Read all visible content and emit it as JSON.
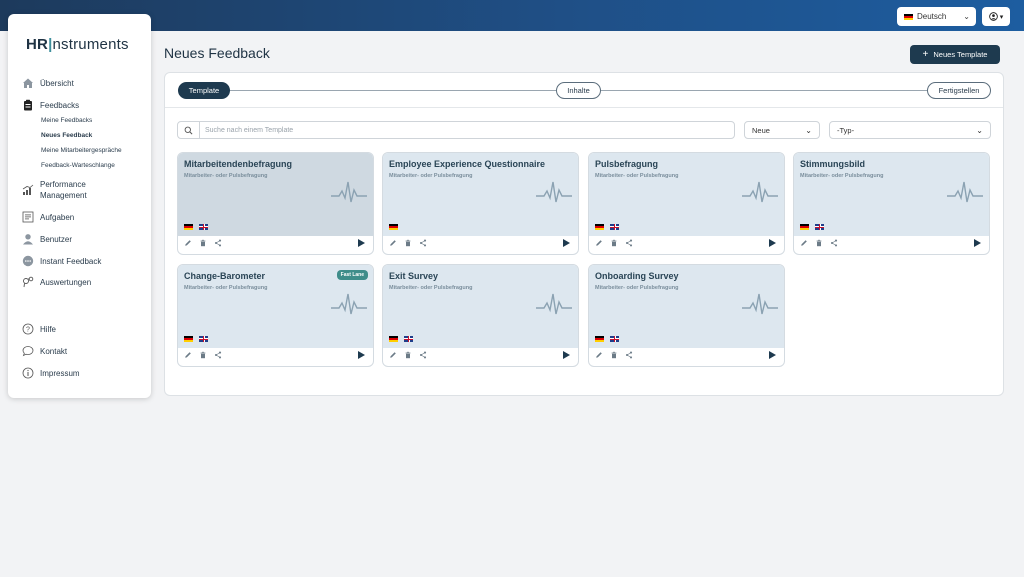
{
  "topbar": {
    "language": "Deutsch"
  },
  "sidebar": {
    "logo_a": "HR",
    "logo_sep": "|",
    "logo_b": "nstruments",
    "items": [
      {
        "label": "Übersicht"
      },
      {
        "label": "Feedbacks"
      },
      {
        "label": "Performance Management"
      },
      {
        "label": "Aufgaben"
      },
      {
        "label": "Benutzer"
      },
      {
        "label": "Instant Feedback"
      },
      {
        "label": "Auswertungen"
      }
    ],
    "sub_items": [
      {
        "label": "Meine Feedbacks"
      },
      {
        "label": "Neues Feedback"
      },
      {
        "label": "Meine Mitarbeitergespräche"
      },
      {
        "label": "Feedback-Warteschlange"
      }
    ],
    "footer_items": [
      {
        "label": "Hilfe"
      },
      {
        "label": "Kontakt"
      },
      {
        "label": "Impressum"
      }
    ]
  },
  "main": {
    "title": "Neues Feedback",
    "new_template_label": "Neues Template",
    "steps": [
      "Template",
      "Inhalte",
      "Fertigstellen"
    ],
    "search_placeholder": "Suche nach einem Template",
    "sort_value": "Neue",
    "type_value": "-Typ-",
    "cards": [
      {
        "title": "Mitarbeitendenbefragung",
        "subtitle": "Mitarbeiter- oder Pulsbefragung",
        "flags": [
          "de",
          "gb"
        ]
      },
      {
        "title": "Employee Experience Questionnaire",
        "subtitle": "Mitarbeiter- oder Pulsbefragung",
        "flags": [
          "de"
        ]
      },
      {
        "title": "Pulsbefragung",
        "subtitle": "Mitarbeiter- oder Pulsbefragung",
        "flags": [
          "de",
          "gb"
        ]
      },
      {
        "title": "Stimmungsbild",
        "subtitle": "Mitarbeiter- oder Pulsbefragung",
        "flags": [
          "de",
          "gb"
        ]
      },
      {
        "title": "Change-Barometer",
        "subtitle": "Mitarbeiter- oder Pulsbefragung",
        "flags": [
          "de",
          "gb"
        ],
        "badge": "Fast Lane"
      },
      {
        "title": "Exit Survey",
        "subtitle": "Mitarbeiter- oder Pulsbefragung",
        "flags": [
          "de",
          "gb"
        ]
      },
      {
        "title": "Onboarding Survey",
        "subtitle": "Mitarbeiter- oder Pulsbefragung",
        "flags": [
          "de",
          "gb"
        ]
      }
    ]
  },
  "colors": {
    "primary": "#1e3a4f",
    "accent": "#3f8d8a",
    "card_bg": "#dde7ef",
    "topbar": "#1f4f86"
  }
}
